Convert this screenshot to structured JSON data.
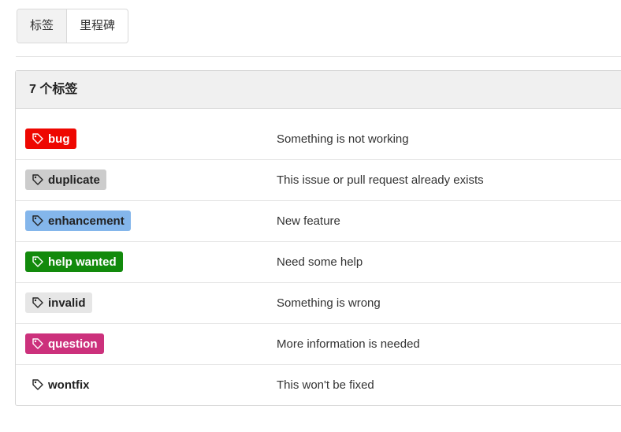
{
  "tabs": [
    {
      "label": "标签",
      "active": true
    },
    {
      "label": "里程碑",
      "active": false
    }
  ],
  "panel": {
    "title": "7 个标签"
  },
  "labels": [
    {
      "name": "bug",
      "description": "Something is not working",
      "color": "#ee0701",
      "text_color": "#ffffff"
    },
    {
      "name": "duplicate",
      "description": "This issue or pull request already exists",
      "color": "#cccccc",
      "text_color": "#222222"
    },
    {
      "name": "enhancement",
      "description": "New feature",
      "color": "#84b6eb",
      "text_color": "#222222"
    },
    {
      "name": "help wanted",
      "description": "Need some help",
      "color": "#128a0c",
      "text_color": "#ffffff"
    },
    {
      "name": "invalid",
      "description": "Something is wrong",
      "color": "#e6e6e6",
      "text_color": "#222222"
    },
    {
      "name": "question",
      "description": "More information is needed",
      "color": "#cc317c",
      "text_color": "#ffffff"
    },
    {
      "name": "wontfix",
      "description": "This won't be fixed",
      "color": "#ffffff",
      "text_color": "#222222"
    }
  ],
  "icons": {
    "label": "tag-icon"
  }
}
